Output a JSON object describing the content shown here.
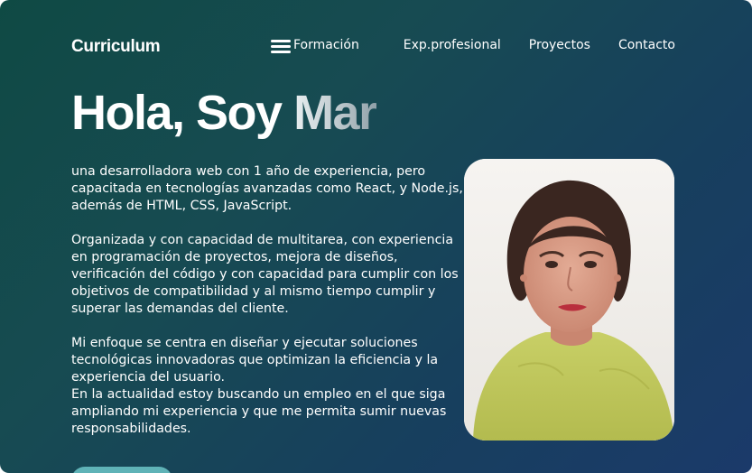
{
  "header": {
    "logo": "Curriculum",
    "menu_icon": "hamburger-menu-icon",
    "nav": [
      "Formación",
      "Exp.profesional",
      "Proyectos",
      "Contacto"
    ]
  },
  "hero": {
    "greeting": "Hola, Soy ",
    "typed_name": "Mar",
    "paragraphs": [
      "una desarrolladora web con 1 año de experiencia, pero capacitada en tecnologías avanzadas como React, y Node.js, además de HTML, CSS, JavaScript.",
      "Organizada y con capacidad de multitarea, con experiencia en programación de proyectos, mejora de diseños, verificación del código y con capacidad para cumplir con los objetivos de compatibilidad y al mismo tiempo cumplir y superar las demandas del cliente.",
      "Mi enfoque se centra en diseñar y ejecutar soluciones tecnológicas innovadoras que optimizan la eficiencia y la experiencia del usuario.",
      "En la actualidad estoy buscando un empleo en el que siga ampliando mi experiencia y que me permita sumir nuevas responsabilidades."
    ]
  },
  "colors": {
    "background_start": "#0f4a44",
    "background_end": "#1b3a6a",
    "accent": "#5fb3b7",
    "text": "#ffffff"
  }
}
